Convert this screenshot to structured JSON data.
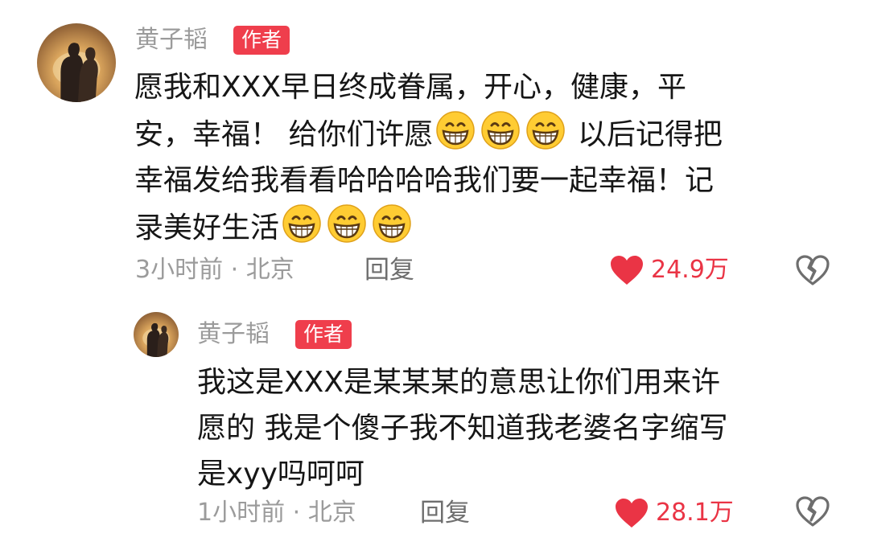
{
  "comments": [
    {
      "username": "黄子韬",
      "badge": "作者",
      "lines": [
        "愿我和XXX早日终成眷属，开心，健康，平",
        "安，幸福！ 给你们许愿",
        " 以后记得把",
        "幸福发给我看看哈哈哈哈我们要一起幸福！记",
        "录美好生活"
      ],
      "emoji": "grinning-face-emoji",
      "time_location": "3小时前 · 北京",
      "reply_label": "回复",
      "like_count": "24.9万"
    },
    {
      "username": "黄子韬",
      "badge": "作者",
      "lines": [
        "我这是XXX是某某某的意思让你们用来许",
        "愿的 我是个傻子我不知道我老婆名字缩写",
        "是xyy吗呵呵"
      ],
      "time_location": "1小时前 · 北京",
      "reply_label": "回复",
      "like_count": "28.1万"
    }
  ],
  "colors": {
    "accent_red": "#ef3e4c",
    "like_red": "#ea3445",
    "meta_gray": "#9b9b9b"
  },
  "icons": [
    "heart-filled-icon",
    "broken-heart-icon",
    "grinning-face-emoji",
    "avatar-couple-silhouette"
  ]
}
